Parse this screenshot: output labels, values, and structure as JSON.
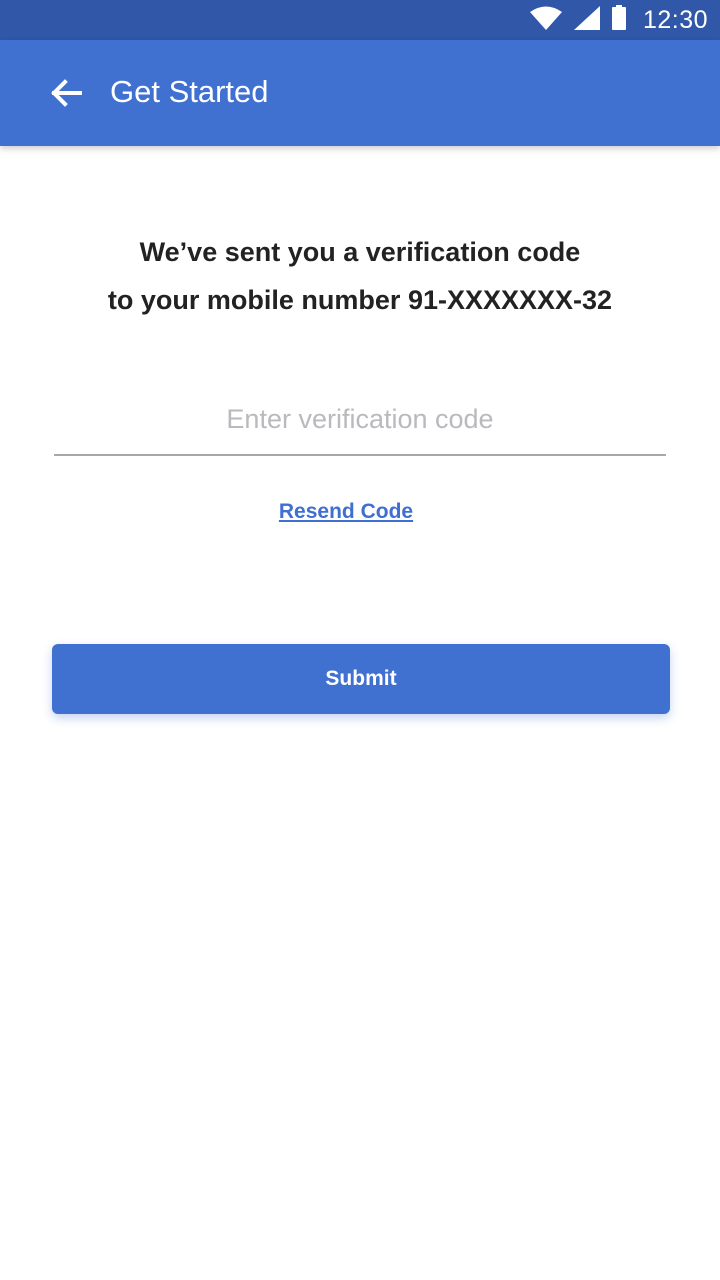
{
  "status_bar": {
    "time": "12:30",
    "icons": [
      "wifi-icon",
      "signal-icon",
      "battery-icon"
    ]
  },
  "app_bar": {
    "title": "Get Started",
    "back_icon": "arrow-back-icon"
  },
  "message": {
    "line1": "We’ve sent you a verification code",
    "line2": "to your mobile number 91-XXXXXXX-32"
  },
  "verification": {
    "value": "",
    "placeholder": "Enter verification code"
  },
  "resend_label": "Resend Code",
  "submit_label": "Submit",
  "colors": {
    "status_bar": "#3157a8",
    "primary": "#4070d0",
    "text": "#222222",
    "placeholder": "#b9b9be"
  }
}
